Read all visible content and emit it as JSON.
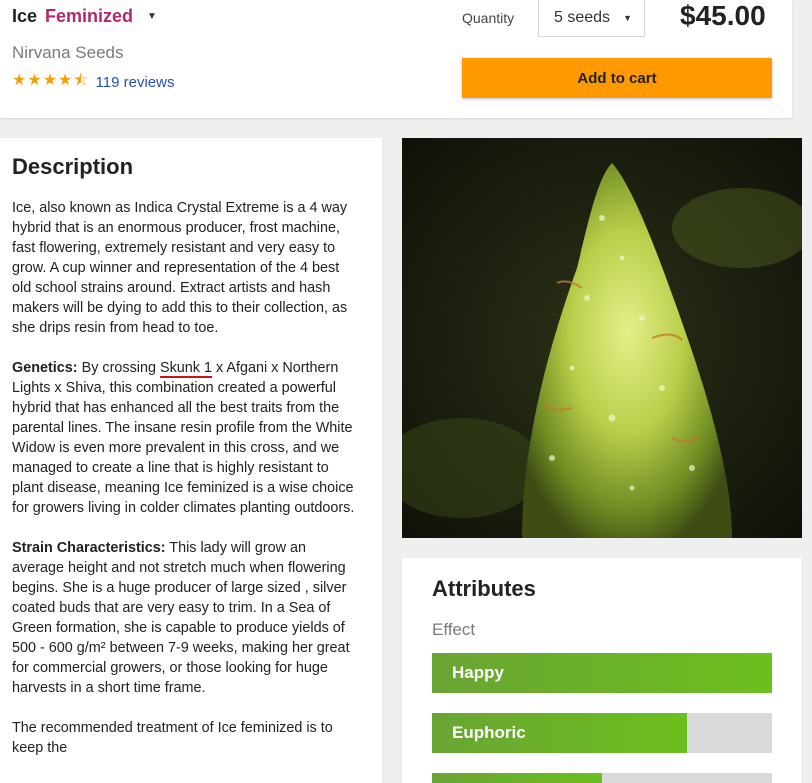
{
  "header": {
    "name": "Ice",
    "type": "Feminized",
    "brand": "Nirvana Seeds",
    "stars": "★★★★⯪",
    "reviews": "119 reviews",
    "quantity_label": "Quantity",
    "quantity_value": "5 seeds",
    "price": "$45.00",
    "cart_label": "Add to cart"
  },
  "description": {
    "title": "Description",
    "intro": "Ice, also known as Indica Crystal Extreme is a 4 way hybrid that is an enormous producer, frost machine, fast flowering, extremely resistant and very easy to grow. A cup winner and representation of the 4 best old school strains around. Extract artists and hash makers will be dying to add this to their collection, as she drips resin from head to toe.",
    "genetics_label": "Genetics:",
    "genetics_pre": " By crossing ",
    "genetics_mark": "Skunk 1",
    "genetics_rest": " x Afgani x Northern Lights x Shiva, this combination created a powerful hybrid that has enhanced all the best traits from the parental lines. The insane resin profile from the White Widow is even more prevalent in this cross, and we managed to create a line that is highly resistant to plant disease, meaning Ice feminized is a wise choice for growers living in colder climates planting outdoors.",
    "strain_label": "Strain Characteristics:",
    "strain_text": " This lady will grow an average height and not stretch much when flowering begins. She is a huge producer of large sized , silver coated buds that are very easy to trim. In a Sea of Green formation, she is capable to produce yields of 500 - 600 g/m² between 7-9 weeks, making her great for commercial growers, or those looking for huge harvests in a short time frame.",
    "next_text": "The recommended treatment of Ice feminized is to keep the"
  },
  "attributes": {
    "title": "Attributes",
    "effect_label": "Effect",
    "effects": [
      {
        "label": "Happy",
        "level": 1.0
      },
      {
        "label": "Euphoric",
        "level": 0.75
      },
      {
        "label": "",
        "level": 0.5
      }
    ]
  },
  "colors": {
    "accent_cart": "#ff9900",
    "feminized": "#b02a6b",
    "bar_fill": "#6cbf1e",
    "star": "#f0a20b",
    "link": "#2451b5"
  }
}
